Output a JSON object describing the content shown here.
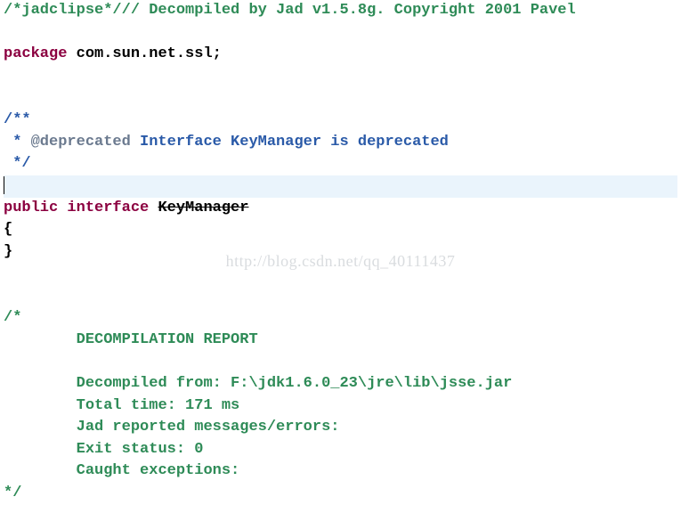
{
  "code": {
    "header_comment_pre": "/*jadclipse*/",
    "header_comment_post": "// Decompiled by Jad v1.5.8g. Copyright 2001 Pavel",
    "kw_package": "package",
    "package_name": " com.sun.net.ssl;",
    "javadoc_open": "/**",
    "javadoc_star": " * ",
    "javadoc_tag": "@deprecated",
    "javadoc_text": " Interface KeyManager is deprecated",
    "javadoc_close": " */",
    "kw_public": "public",
    "kw_interface": " interface ",
    "classname": "KeyManager",
    "brace_open": "{",
    "brace_close": "}",
    "report_open": "/*",
    "report_title": "\tDECOMPILATION REPORT",
    "report_from": "\tDecompiled from: F:\\jdk1.6.0_23\\jre\\lib\\jsse.jar",
    "report_time": "\tTotal time: 171 ms",
    "report_msgs": "\tJad reported messages/errors:",
    "report_exit": "\tExit status: 0",
    "report_caught": "\tCaught exceptions:",
    "report_close": "*/"
  },
  "watermark": "http://blog.csdn.net/qq_40111437"
}
